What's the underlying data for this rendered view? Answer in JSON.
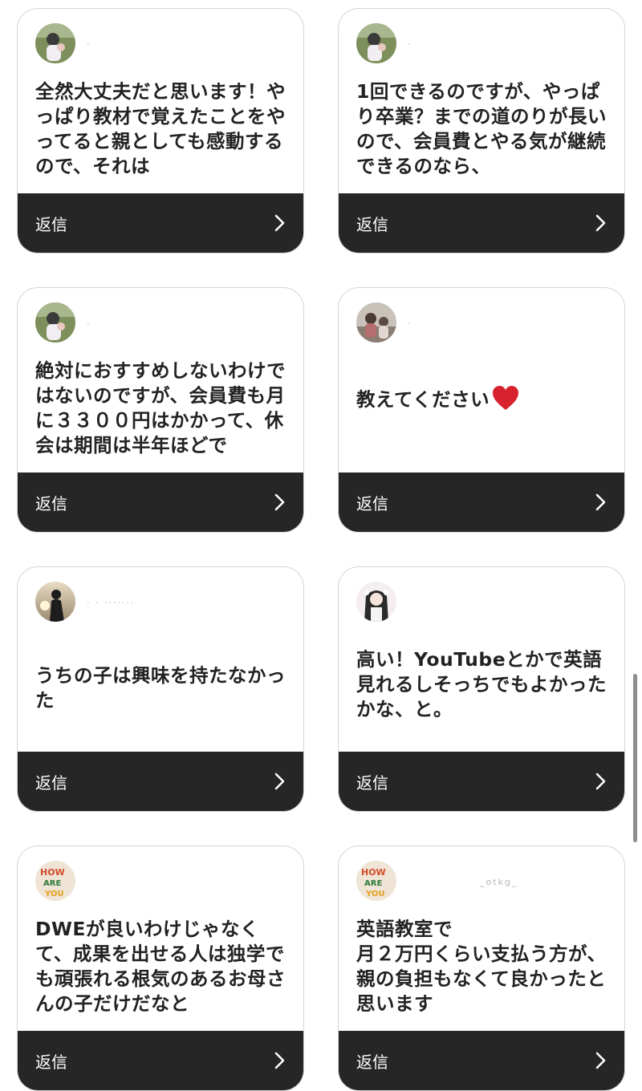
{
  "reply_label": "返信",
  "cards": [
    {
      "username": "·",
      "message": "全然大丈夫だと思います！やっぱり教材で覚えたことをやってると親としても感動するので、それは",
      "avatar": "child-outdoor-photo"
    },
    {
      "username": "·",
      "message": "1回できるのですが、やっぱり卒業？までの道のりが長いので、会員費とやる気が継続できるのなら、",
      "avatar": "child-outdoor-photo"
    },
    {
      "username": "·",
      "message": "絶対におすすめしないわけではないのですが、会員費も月に３３００円はかかって、休会は期間は半年ほどで",
      "avatar": "child-outdoor-photo"
    },
    {
      "username": "·",
      "message": "教えてください",
      "emoji": "heart-icon",
      "avatar": "family-indoor-photo"
    },
    {
      "username": "·  ·  ·······",
      "message": "うちの子は興味を持たなかった",
      "avatar": "silhouette-sunset-photo"
    },
    {
      "username": "",
      "message": "高い！YouTubeとかで英語見れるしそっちでもよかったかな、と。",
      "avatar": "anime-girl-avatar"
    },
    {
      "username": "",
      "message": "DWEが良いわけじゃなくて、成果を出せる人は独学でも頑張れる根気のあるお母さんの子だけだなと",
      "avatar": "how-are-you-poster"
    },
    {
      "username": "_otkg_",
      "message": "英語教室で\n月２万円くらい支払う方が、親の負担もなくて良かったと思います",
      "avatar": "how-are-you-poster"
    }
  ]
}
